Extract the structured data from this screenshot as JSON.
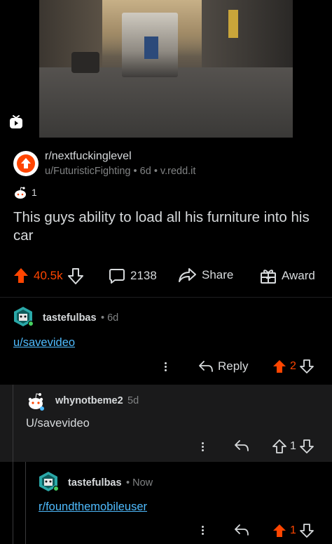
{
  "post": {
    "subreddit": "r/nextfuckinglevel",
    "author": "u/FuturisticFighting",
    "age": "6d",
    "domain": "v.redd.it",
    "award_count": "1",
    "title": "This guys ability to load all his furniture into his car",
    "upvotes": "40.5k",
    "comments": "2138",
    "share_label": "Share",
    "award_label": "Award"
  },
  "comments": [
    {
      "author": "tastefulbas",
      "time": "6d",
      "body": "u/savevideo",
      "reply_label": "Reply",
      "score": "2",
      "upvoted": true
    },
    {
      "author": "whynotbeme2",
      "time": "5d",
      "body": "U/savevideo",
      "score": "1",
      "upvoted": false
    },
    {
      "author": "tastefulbas",
      "time": "Now",
      "body": "r/foundthemobileuser",
      "score": "1",
      "upvoted": true
    }
  ],
  "colors": {
    "accent": "#ff4500",
    "link": "#4fbcff",
    "text": "#d7dadc",
    "muted": "#818384"
  },
  "icons": [
    "video-icon",
    "subreddit-upvote-icon",
    "award-snoo-icon",
    "upvote-icon",
    "downvote-icon",
    "comment-icon",
    "share-icon",
    "award-icon",
    "more-icon",
    "reply-icon"
  ]
}
